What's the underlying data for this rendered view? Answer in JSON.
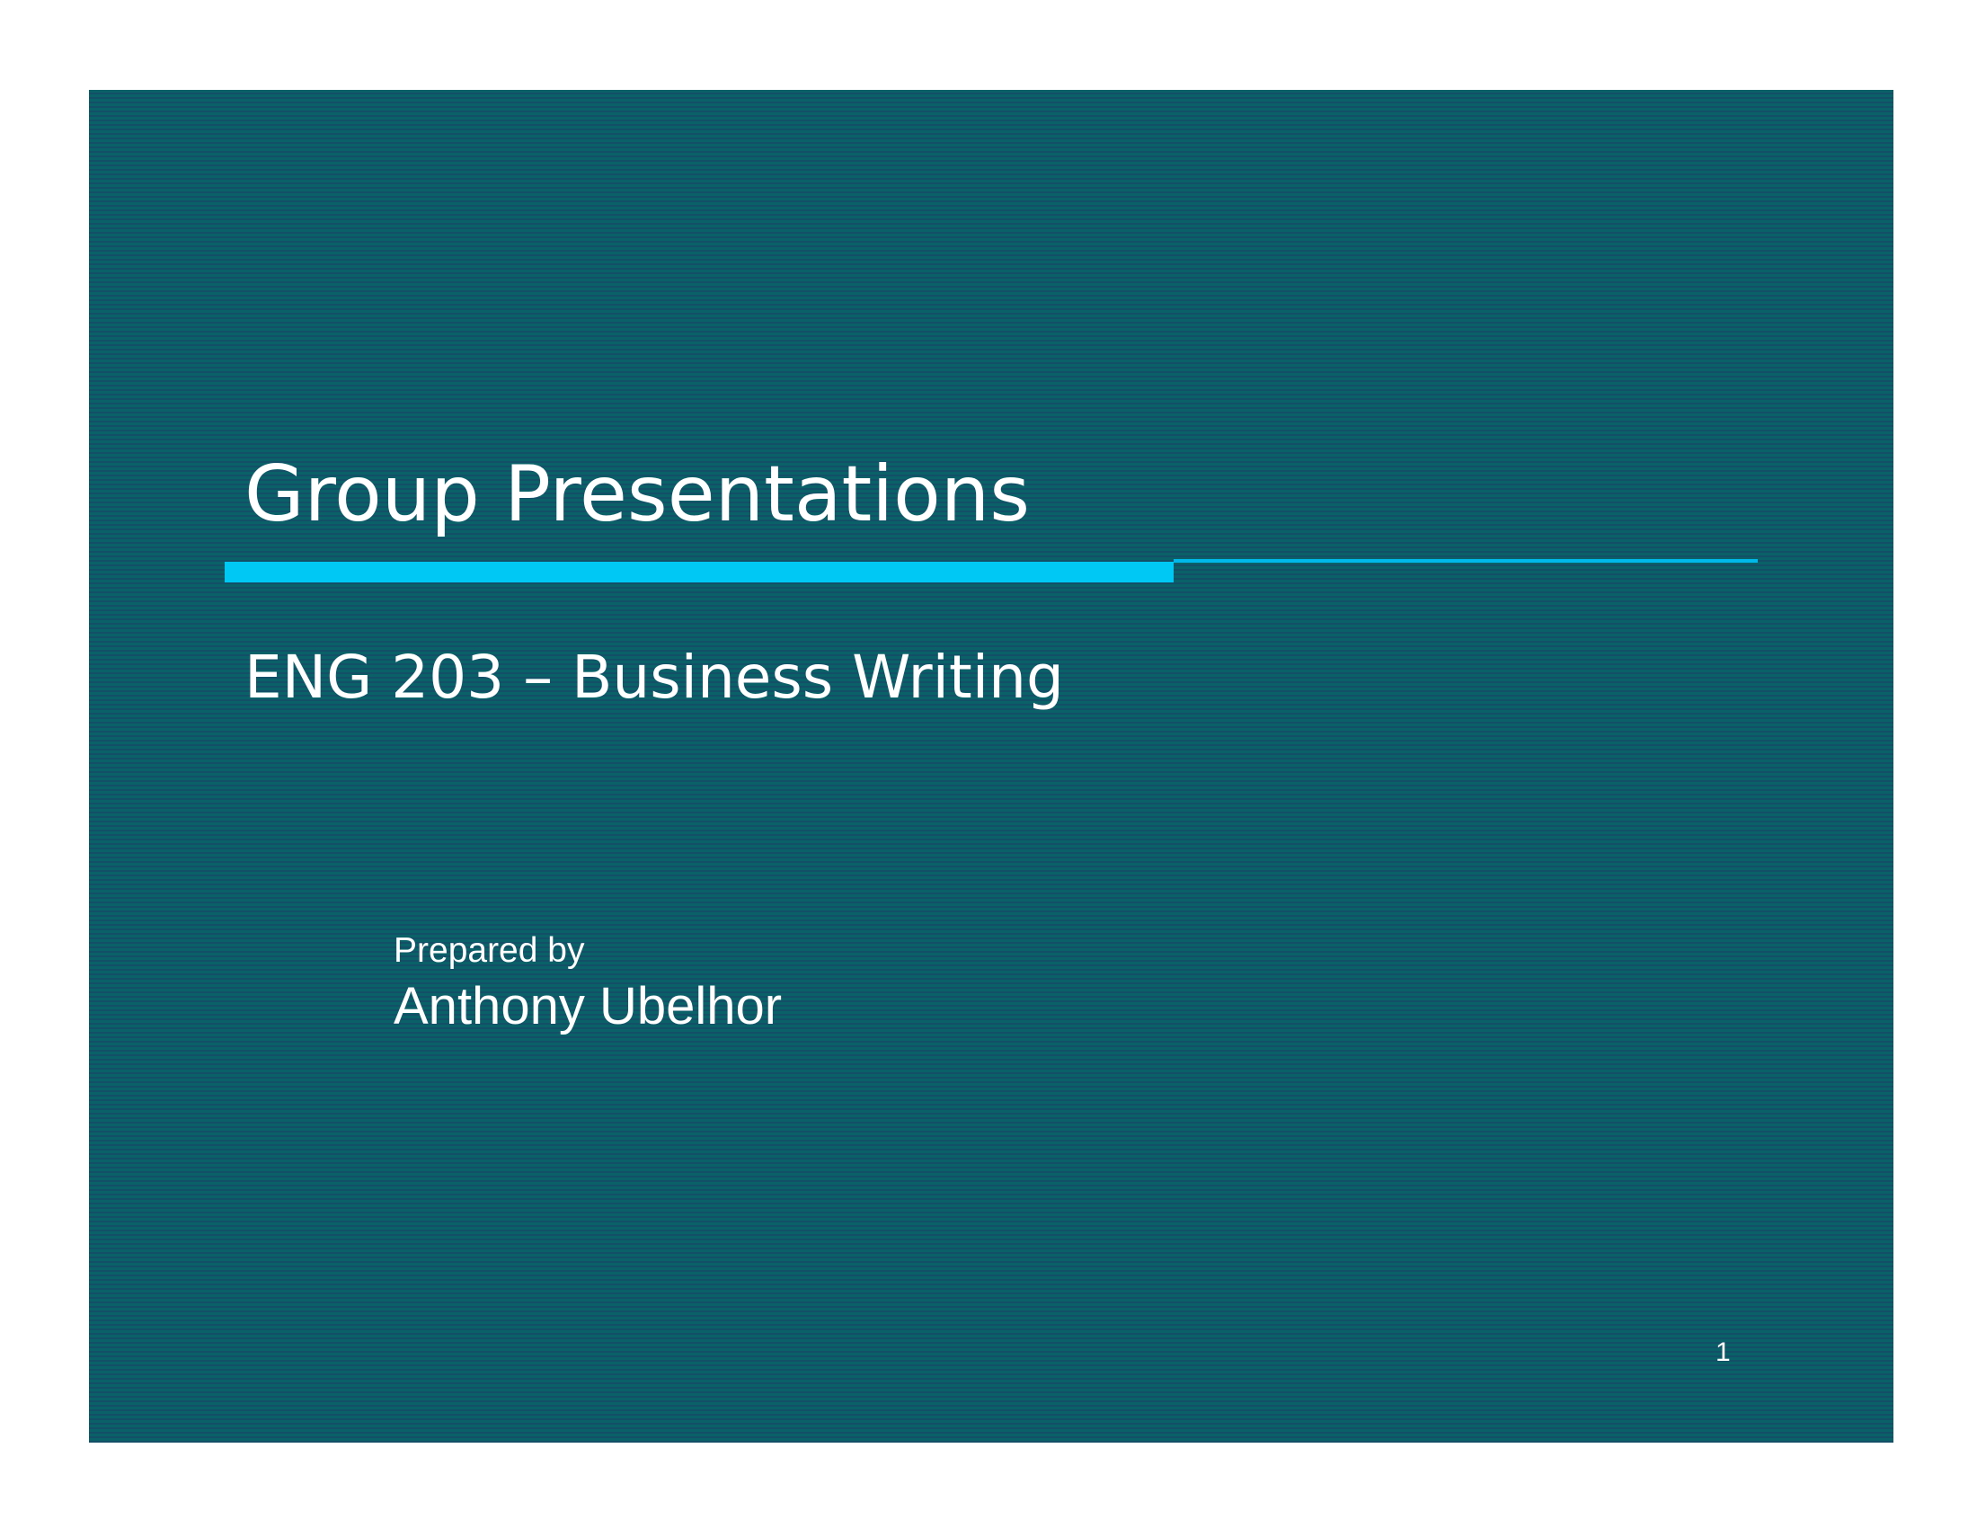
{
  "slide": {
    "title": "Group Presentations",
    "subtitle": "ENG 203 – Business Writing",
    "prepared_label": "Prepared by",
    "author": "Anthony Ubelhor",
    "page_number": "1"
  },
  "colors": {
    "background": "#0f5b67",
    "accent": "#00c8f5",
    "text": "#ffffff"
  }
}
